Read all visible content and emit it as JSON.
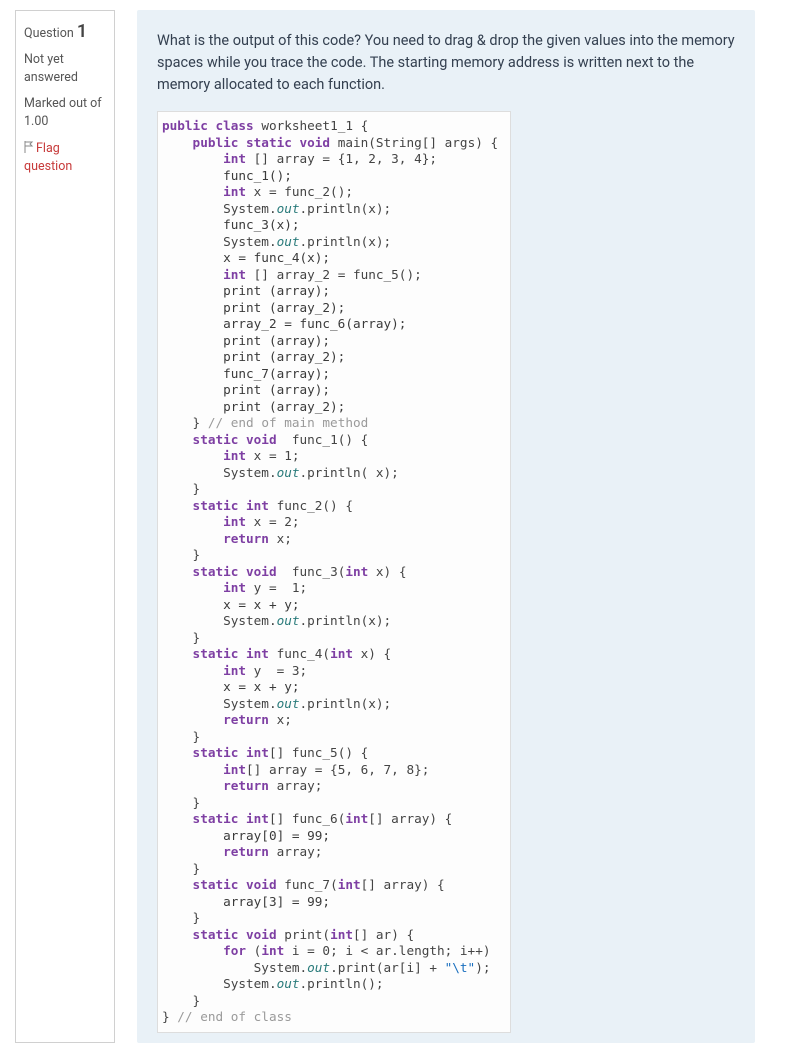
{
  "info": {
    "question_label": "Question",
    "question_number": "1",
    "status": "Not yet answered",
    "marked": "Marked out of 1.00",
    "flag": "Flag question"
  },
  "prompt": "What is the output of this code?  You need to drag & drop the given values into the memory spaces while you trace the code. The starting memory address is written next to the memory allocated to each function.",
  "code": {
    "l01_a": "public",
    "l01_b": "class",
    "l01_c": " worksheet1_1 {",
    "l02_a": "    public",
    "l02_b": " static",
    "l02_c": " void",
    "l02_d": " main(String[] args) {",
    "l03_a": "        int",
    "l03_b": " [] array = {1, 2, 3, 4};",
    "l04": "        func_1();",
    "l05_a": "        int",
    "l05_b": " x = func_2();",
    "l06_a": "        System.",
    "l06_b": "out",
    "l06_c": ".println(x);",
    "l07": "        func_3(x);",
    "l08_a": "        System.",
    "l08_b": "out",
    "l08_c": ".println(x);",
    "l09": "        x = func_4(x);",
    "l10_a": "        int",
    "l10_b": " [] array_2 = func_5();",
    "l11": "        print (array);",
    "l12": "        print (array_2);",
    "l13": "        array_2 = func_6(array);",
    "l14": "        print (array);",
    "l15": "        print (array_2);",
    "l16": "        func_7(array);",
    "l17": "        print (array);",
    "l18": "        print (array_2);",
    "l19_a": "    } ",
    "l19_b": "// end of main method",
    "l20_a": "    static",
    "l20_b": " void",
    "l20_c": "  func_1() {",
    "l21_a": "        int",
    "l21_b": " x = 1;",
    "l22_a": "        System.",
    "l22_b": "out",
    "l22_c": ".println( x);",
    "l23": "    }",
    "l24_a": "    static",
    "l24_b": " int",
    "l24_c": " func_2() {",
    "l25_a": "        int",
    "l25_b": " x = 2;",
    "l26_a": "        return",
    "l26_b": " x;",
    "l27": "    }",
    "l28_a": "    static",
    "l28_b": " void",
    "l28_c": "  func_3(",
    "l28_d": "int",
    "l28_e": " x) {",
    "l29_a": "        int",
    "l29_b": " y =  1;",
    "l30": "        x = x + y;",
    "l31_a": "        System.",
    "l31_b": "out",
    "l31_c": ".println(x);",
    "l32": "    }",
    "l33_a": "    static",
    "l33_b": " int",
    "l33_c": " func_4(",
    "l33_d": "int",
    "l33_e": " x) {",
    "l34_a": "        int",
    "l34_b": " y  = 3;",
    "l35": "        x = x + y;",
    "l36_a": "        System.",
    "l36_b": "out",
    "l36_c": ".println(x);",
    "l37_a": "        return",
    "l37_b": " x;",
    "l38": "    }",
    "l39_a": "    static",
    "l39_b": " int",
    "l39_c": "[] func_5() {",
    "l40_a": "        int",
    "l40_b": "[] array = {5, 6, 7, 8};",
    "l41_a": "        return",
    "l41_b": " array;",
    "l42": "    }",
    "l43_a": "    static",
    "l43_b": " int",
    "l43_c": "[] func_6(",
    "l43_d": "int",
    "l43_e": "[] array) {",
    "l44": "        array[0] = 99;",
    "l45_a": "        return",
    "l45_b": " array;",
    "l46": "    }",
    "l47_a": "    static",
    "l47_b": " void",
    "l47_c": " func_7(",
    "l47_d": "int",
    "l47_e": "[] array) {",
    "l48": "        array[3] = 99;",
    "l49": "    }",
    "l50_a": "    static",
    "l50_b": " void",
    "l50_c": " print(",
    "l50_d": "int",
    "l50_e": "[] ar) {",
    "l51_a": "        for",
    "l51_b": " (",
    "l51_c": "int",
    "l51_d": " i = 0; i < ar.length; i++)",
    "l52_a": "            System.",
    "l52_b": "out",
    "l52_c": ".print(ar[i] + ",
    "l52_d": "\"\\t\"",
    "l52_e": ");",
    "l53_a": "        System.",
    "l53_b": "out",
    "l53_c": ".println();",
    "l54": "    }",
    "l55_a": "} ",
    "l55_b": "// end of class"
  }
}
